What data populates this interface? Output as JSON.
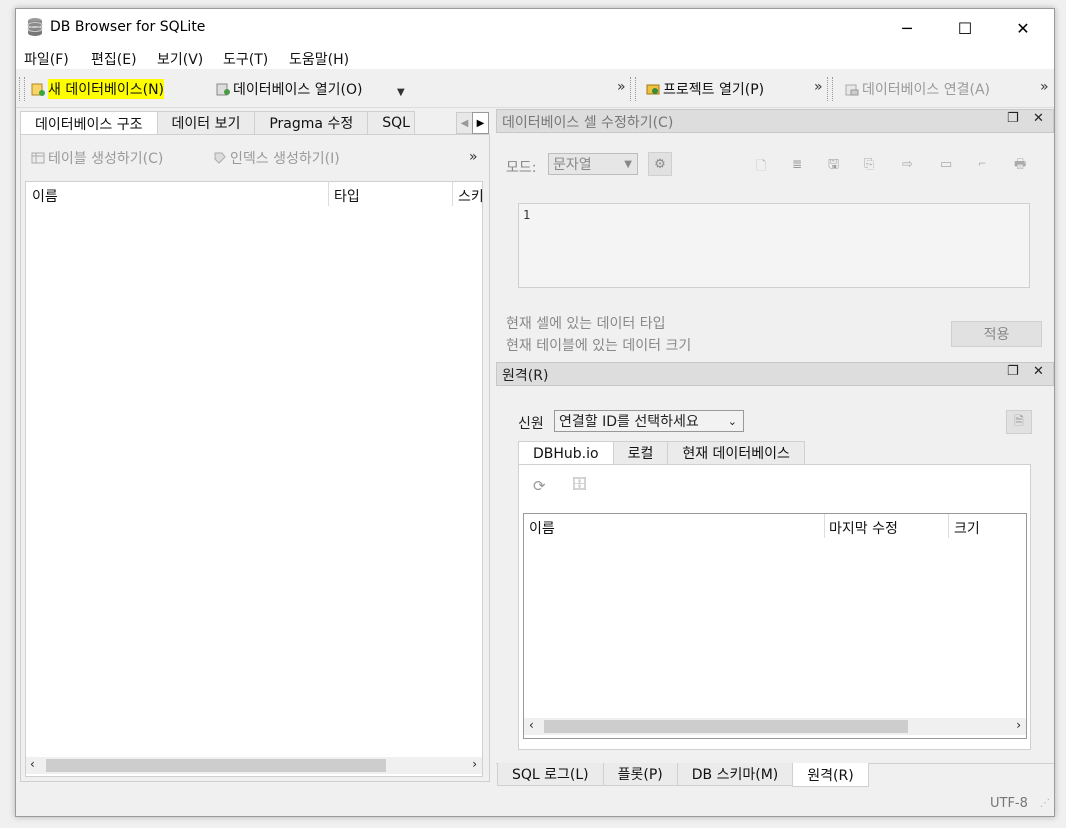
{
  "window": {
    "title": "DB Browser for SQLite",
    "min": "─",
    "max": "☐",
    "close": "✕"
  },
  "menu": [
    "파일(F)",
    "편집(E)",
    "보기(V)",
    "도구(T)",
    "도움말(H)"
  ],
  "toolbar": {
    "new_db": "새 데이터베이스(N)",
    "open_db": "데이터베이스 열기(O)",
    "open_project": "프로젝트 열기(P)",
    "attach_db": "데이터베이스 연결(A)",
    "more": "»"
  },
  "left": {
    "tabs": [
      "데이터베이스 구조",
      "데이터 보기",
      "Pragma 수정",
      "SQL"
    ],
    "create_table": "테이블 생성하기(C)",
    "create_index": "인덱스 생성하기(I)",
    "more": "»",
    "columns": [
      "이름",
      "타입",
      "스키"
    ]
  },
  "edit_cell": {
    "title": "데이터베이스 셀 수정하기(C)",
    "mode_label": "모드:",
    "mode_value": "문자열",
    "content": "1",
    "type_text": "현재 셀에 있는 데이터 타입",
    "size_text": "현재 테이블에 있는 데이터 크기",
    "apply": "적용"
  },
  "remote": {
    "title": "원격(R)",
    "identity_label": "신원",
    "identity_value": "연결할 ID를 선택하세요",
    "tabs": [
      "DBHub.io",
      "로컬",
      "현재 데이터베이스"
    ],
    "columns": [
      "이름",
      "마지막 수정",
      "크기"
    ]
  },
  "bottom_tabs": [
    "SQL 로그(L)",
    "플롯(P)",
    "DB 스키마(M)",
    "원격(R)"
  ],
  "status": {
    "encoding": "UTF-8"
  },
  "colors": {
    "highlight": "#ffff00",
    "window_bg": "#f0f0f0"
  }
}
